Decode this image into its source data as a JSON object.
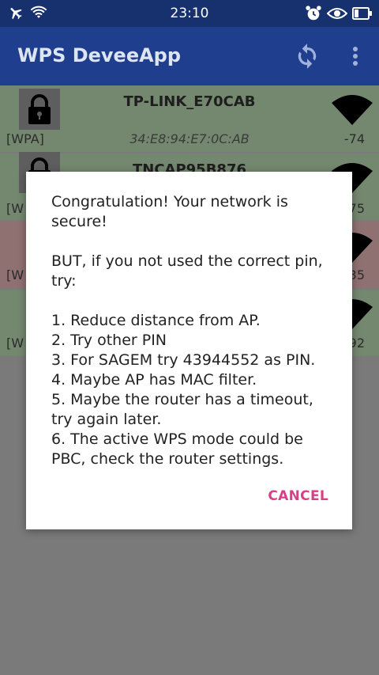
{
  "status_bar": {
    "time": "23:10",
    "left_icons": [
      "airplane-icon",
      "wifi-icon"
    ],
    "right_icons": [
      "alarm-icon",
      "eye-icon",
      "battery-icon"
    ]
  },
  "app_bar": {
    "title": "WPS DeveeApp",
    "actions": [
      "refresh-icon",
      "overflow-menu-icon"
    ]
  },
  "networks": [
    {
      "ssid": "TP-LINK_E70CAB",
      "security": "[WPA]",
      "bssid": "34:E8:94:E7:0C:AB",
      "rssi": "-74",
      "state": "green"
    },
    {
      "ssid": "TNCAP95B876",
      "security": "[W",
      "bssid": "",
      "rssi": "75",
      "state": "green"
    },
    {
      "ssid": "",
      "security": "[W",
      "bssid": "",
      "rssi": "35",
      "state": "red"
    },
    {
      "ssid": "",
      "security": "[W",
      "bssid": "",
      "rssi": "92",
      "state": "green"
    }
  ],
  "dialog": {
    "message": "Congratulation! Your network is secure!\n\nBUT, if you not used the correct pin, try:\n\n1. Reduce distance from AP.\n2. Try other PIN\n3. For SAGEM try 43944552 as PIN.\n4. Maybe AP has MAC filter.\n5. Maybe the router has a timeout, try again later.\n6. The active WPS mode could be PBC, check the router settings.",
    "cancel_label": "CANCEL"
  },
  "colors": {
    "status_bar": "#17316e",
    "app_bar": "#1f3f8e",
    "row_green": "#74876f",
    "row_red": "#8f7171",
    "accent": "#d93f86"
  }
}
